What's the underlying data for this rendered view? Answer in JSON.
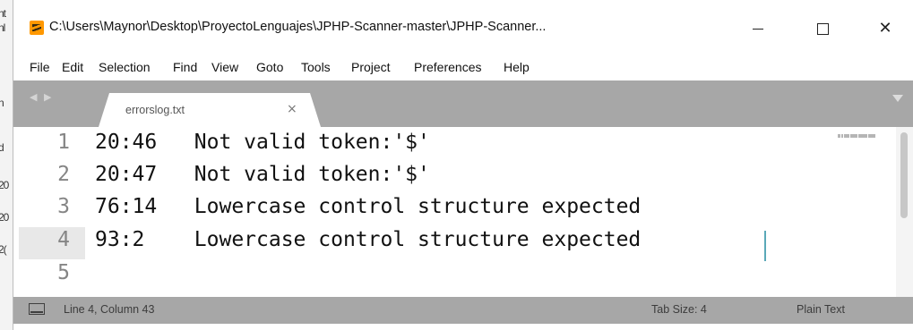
{
  "background_window": {
    "fragments": [
      "nt",
      "nl",
      "n",
      "d",
      "20",
      "20",
      "2("
    ]
  },
  "window": {
    "title": "C:\\Users\\Maynor\\Desktop\\ProyectoLenguajes\\JPHP-Scanner-master\\JPHP-Scanner...",
    "app_icon": "sublime-text-icon",
    "controls": {
      "minimize_icon": "minimize-icon",
      "maximize_icon": "maximize-icon",
      "close_label": "✕"
    }
  },
  "menu": [
    {
      "label": "File"
    },
    {
      "label": "Edit"
    },
    {
      "label": "Selection"
    },
    {
      "label": "Find"
    },
    {
      "label": "View"
    },
    {
      "label": "Goto"
    },
    {
      "label": "Tools"
    },
    {
      "label": "Project"
    },
    {
      "label": "Preferences"
    },
    {
      "label": "Help"
    }
  ],
  "tabs": [
    {
      "label": "errorslog.txt",
      "close_label": "×",
      "active": true
    }
  ],
  "tabbar": {
    "nav_arrows": "◀ ▶",
    "dropdown_icon": "dropdown-triangle-icon"
  },
  "editor": {
    "lines": [
      {
        "num": "1",
        "text": "20:46   Not valid token:'$'"
      },
      {
        "num": "2",
        "text": "20:47   Not valid token:'$'"
      },
      {
        "num": "3",
        "text": "76:14   Lowercase control structure expected"
      },
      {
        "num": "4",
        "text": "93:2    Lowercase control structure expected"
      },
      {
        "num": "5",
        "text": ""
      }
    ],
    "active_line": "4"
  },
  "status": {
    "position": "Line 4, Column 43",
    "tab_size": "Tab Size: 4",
    "syntax": "Plain Text"
  },
  "colors": {
    "tabbar_bg": "#a7a7a7",
    "cursor": "#5aa8b8",
    "line_number": "#858585"
  }
}
